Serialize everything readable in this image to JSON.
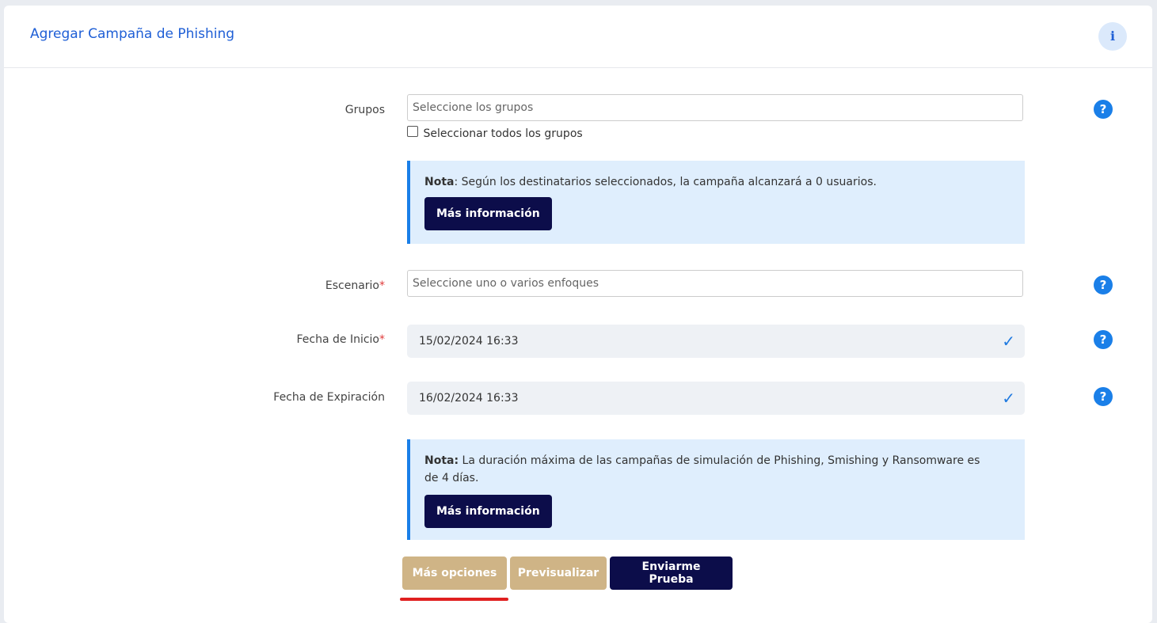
{
  "header": {
    "title": "Agregar Campaña de Phishing",
    "info_icon_glyph": "i"
  },
  "form": {
    "groups": {
      "label": "Grupos",
      "placeholder": "Seleccione los grupos",
      "select_all_label": "Seleccionar todos los grupos"
    },
    "note1": {
      "bold": "Nota",
      "text": ": Según los destinatarios seleccionados, la campaña alcanzará a 0 usuarios.",
      "button": "Más información"
    },
    "scenario": {
      "label": "Escenario",
      "required_mark": "*",
      "placeholder": "Seleccione uno o varios enfoques"
    },
    "start_date": {
      "label": "Fecha de Inicio",
      "required_mark": "*",
      "value": "15/02/2024 16:33"
    },
    "expiry_date": {
      "label": "Fecha de Expiración",
      "value": "16/02/2024 16:33"
    },
    "note2": {
      "bold": "Nota:",
      "text": " La duración máxima de las campañas de simulación de Phishing, Smishing y Ransomware es de 4 días.",
      "button": "Más información"
    },
    "help_glyph": "?",
    "check_glyph": "✓"
  },
  "actions": {
    "more_options": "Más opciones",
    "preview": "Previsualizar",
    "send_test": "Enviarme Prueba"
  },
  "colors": {
    "accent": "#1f5fd6",
    "dark_button": "#0c0d4a",
    "tan_button": "#cfb486",
    "highlight_underline": "#e02020"
  }
}
